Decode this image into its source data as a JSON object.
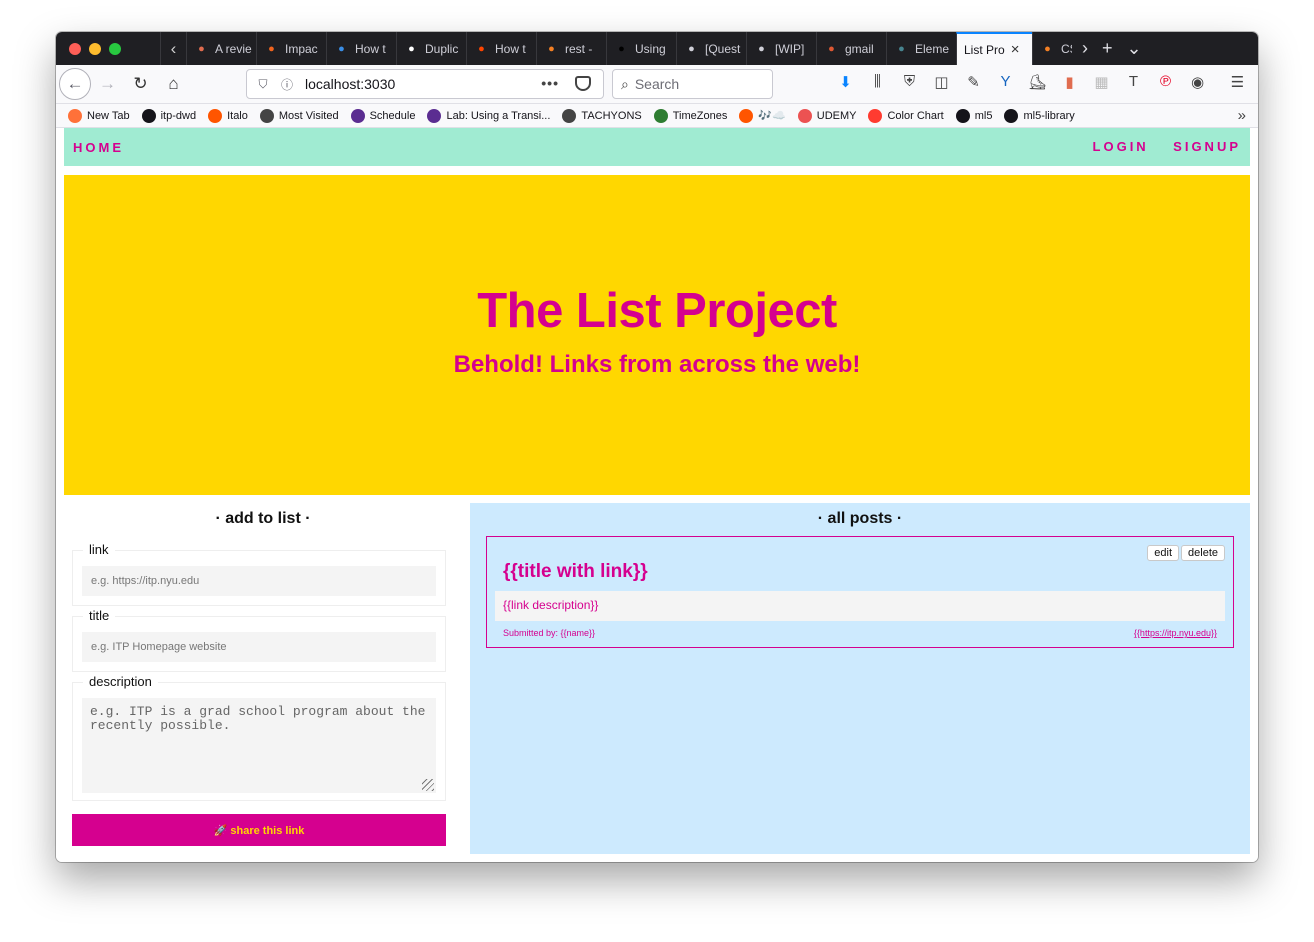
{
  "browser": {
    "tabs": [
      {
        "label": "A revie",
        "icon": "red-bullet-icon",
        "color": "#e06c4f"
      },
      {
        "label": "Impac",
        "icon": "etsy-icon",
        "color": "#f1641e"
      },
      {
        "label": "How t",
        "icon": "calendar-check-icon",
        "color": "#3a8ee6"
      },
      {
        "label": "Duplic",
        "icon": "notion-icon",
        "color": "#ffffff"
      },
      {
        "label": "How t",
        "icon": "reddit-icon",
        "color": "#ff4500"
      },
      {
        "label": "rest - ",
        "icon": "stackoverflow-icon",
        "color": "#f48024"
      },
      {
        "label": "Using",
        "icon": "medium-icon",
        "color": "#000000"
      },
      {
        "label": "[Quest",
        "icon": "github-icon",
        "color": "#cfcfd8"
      },
      {
        "label": "[WIP]",
        "icon": "github-icon",
        "color": "#cfcfd8"
      },
      {
        "label": "gmail ",
        "icon": "duckduckgo-icon",
        "color": "#de5833"
      },
      {
        "label": "Eleme",
        "icon": "electron-icon",
        "color": "#47848f"
      },
      {
        "label": "List Pro",
        "icon": "",
        "color": "",
        "active": true
      },
      {
        "label": "CS",
        "icon": "stackoverflow-icon",
        "color": "#f48024"
      }
    ],
    "url": "localhost:3030",
    "search_placeholder": "Search",
    "bookmarks": [
      {
        "label": "New Tab",
        "icon": "firefox-icon",
        "color": "#ff7139"
      },
      {
        "label": "itp-dwd",
        "icon": "github-icon",
        "color": "#15141a"
      },
      {
        "label": "Italo",
        "icon": "soundcloud-icon",
        "color": "#ff5500"
      },
      {
        "label": "Most Visited",
        "icon": "gear-icon",
        "color": "#444444"
      },
      {
        "label": "Schedule",
        "icon": "itp-icon",
        "color": "#5b2d91"
      },
      {
        "label": "Lab: Using a Transi...",
        "icon": "itp-icon",
        "color": "#5b2d91"
      },
      {
        "label": "TACHYONS",
        "icon": "globe-icon",
        "color": "#444444"
      },
      {
        "label": "TimeZones",
        "icon": "timezones-icon",
        "color": "#2e7d32"
      },
      {
        "label": "🎶☁️",
        "icon": "soundcloud-icon",
        "color": "#ff5500"
      },
      {
        "label": "UDEMY",
        "icon": "udemy-icon",
        "color": "#ec5252"
      },
      {
        "label": "Color Chart",
        "icon": "color-chart-icon",
        "color": "#ff3b30"
      },
      {
        "label": "ml5",
        "icon": "github-icon",
        "color": "#15141a"
      },
      {
        "label": "ml5-library",
        "icon": "github-icon",
        "color": "#15141a"
      }
    ]
  },
  "site": {
    "colors": {
      "accent": "#d5008f",
      "nav_bg": "#a0ebd2",
      "hero_bg": "#ffd700",
      "posts_bg": "#cdeafe"
    },
    "nav": {
      "home": "HOME",
      "login": "LOGIN",
      "signup": "SIGNUP"
    },
    "hero": {
      "title": "The List Project",
      "subtitle": "Behold! Links from across the web!"
    },
    "form": {
      "heading": "· add to list ·",
      "link_label": "link",
      "link_placeholder": "e.g. https://itp.nyu.edu",
      "title_label": "title",
      "title_placeholder": "e.g. ITP Homepage website",
      "description_label": "description",
      "description_placeholder": "e.g. ITP is a grad school program about the recently possible.",
      "submit": "🚀 share this link"
    },
    "posts": {
      "heading": "· all posts ·",
      "items": [
        {
          "title": "{{title with link}}",
          "description": "{{link description}}",
          "submitted_by": "Submitted by: {{name}}",
          "url": "{{https://itp.nyu.edu}}",
          "edit": "edit",
          "delete": "delete"
        }
      ]
    }
  }
}
